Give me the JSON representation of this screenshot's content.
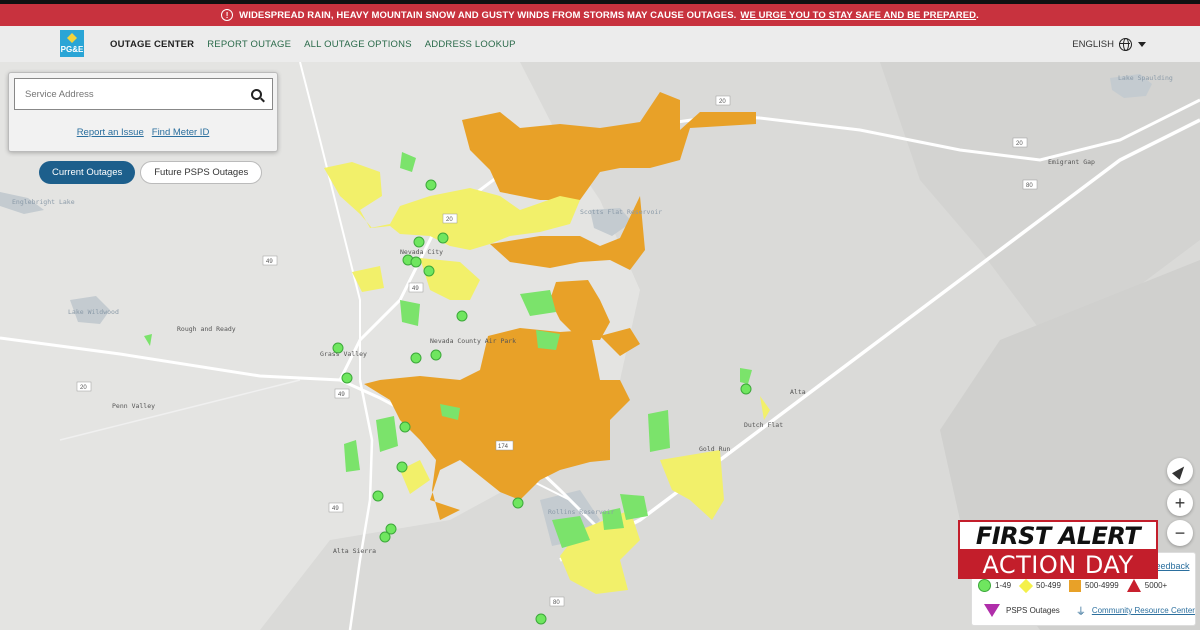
{
  "alert": {
    "icon": "alert-circle-icon",
    "message": "WIDESPREAD RAIN, HEAVY MOUNTAIN SNOW AND GUSTY WINDS FROM STORMS MAY CAUSE OUTAGES.",
    "link_text": "WE URGE YOU TO STAY SAFE AND BE PREPARED",
    "link_suffix": ".",
    "color": "#c8323e"
  },
  "header": {
    "logo_text": "PG&E",
    "nav": [
      "OUTAGE CENTER",
      "REPORT OUTAGE",
      "ALL OUTAGE OPTIONS",
      "ADDRESS LOOKUP"
    ],
    "active_nav": "OUTAGE CENTER",
    "language": "ENGLISH"
  },
  "search": {
    "placeholder": "Service Address",
    "link_report": "Report an Issue",
    "link_meter": "Find Meter ID"
  },
  "toggles": {
    "current": "Current Outages",
    "future": "Future PSPS Outages"
  },
  "map": {
    "labels": [
      "Lake Spaulding",
      "Emigrant Gap",
      "Englebright Lake",
      "Lake Wildwood",
      "Rough and Ready",
      "Grass Valley",
      "Nevada City",
      "Nevada County Air Park",
      "Scotts Flat Reservoir",
      "Penn Valley",
      "Alta Sierra",
      "Rollins Reservoir",
      "Alta",
      "Dutch Flat",
      "Gold Run"
    ],
    "highway_shields": [
      "20",
      "20",
      "20",
      "20",
      "49",
      "49",
      "49",
      "49",
      "174",
      "80",
      "80"
    ],
    "colors": {
      "land": "#d8d8d6",
      "land_light": "#e6e6e4",
      "water": "#c4cbd0",
      "road": "#ffffff",
      "outage_1_49": "#7be36b",
      "outage_50_499": "#f2f06a",
      "outage_500_4999": "#e8a128"
    }
  },
  "controls": {
    "locate": "locate-icon",
    "zoom_in": "+",
    "zoom_out": "−"
  },
  "legend": {
    "feedback": "Feedback",
    "items": [
      {
        "label": "1-49",
        "icon": "green-circle-icon",
        "color": "#6fe65f"
      },
      {
        "label": "50-499",
        "icon": "yellow-diamond-icon",
        "color": "#f4f04a"
      },
      {
        "label": "500-4999",
        "icon": "orange-square-icon",
        "color": "#e8a128"
      },
      {
        "label": "5000+",
        "icon": "red-triangle-icon",
        "color": "#c8202e"
      }
    ],
    "psps": "PSPS Outages",
    "community": "Community Resource Center"
  },
  "badge": {
    "line1": "FIRST ALERT",
    "line2": "ACTION DAY",
    "color": "#c31e2b"
  }
}
